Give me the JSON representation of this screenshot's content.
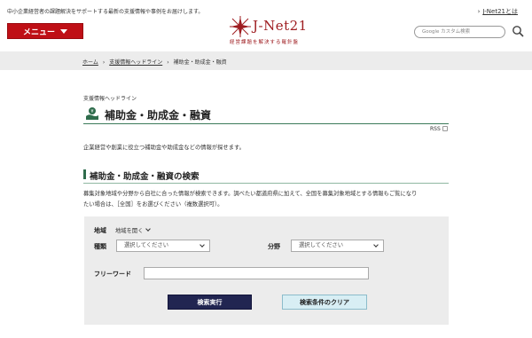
{
  "header": {
    "tagline": "中小企業経営者の課題解決をサポートする最新の支援情報や事例をお届けします。",
    "top_link": "J-Net21とは",
    "menu_label": "メニュー",
    "logo_name": "J-Net21",
    "logo_subtitle": "経営課題を解決する羅針盤",
    "search_placeholder": "Google カスタム検索"
  },
  "breadcrumb": {
    "items": [
      "ホーム",
      "支援情報ヘッドライン",
      "補助金・助成金・融資"
    ],
    "separator": "›"
  },
  "main": {
    "section_label": "支援情報ヘッドライン",
    "title": "補助金・助成金・融資",
    "rss_label": "RSS",
    "intro": "企業経営や創業に役立つ補助金や助成金などの情報が探せます。"
  },
  "search": {
    "title": "補助金・助成金・融資の検索",
    "description_line1": "募集対象地域や分野から自社に合った情報が検索できます。調べたい都道府県に加えて、全国を募集対象地域とする情報もご覧になり",
    "description_line2": "たい場合は、［全国］をお選びください（複数選択可）。",
    "region_label": "地域",
    "region_toggle": "地域を開く",
    "type_label": "種類",
    "type_placeholder": "選択してください",
    "field_label": "分野",
    "field_placeholder": "選択してください",
    "freeword_label": "フリーワード",
    "freeword_value": "",
    "submit_label": "検索実行",
    "clear_label": "検索条件のクリア"
  },
  "colors": {
    "menu_red": "#bf0f16",
    "brand_red": "#9e1c20",
    "accent_green": "#2f6c4c",
    "search_button": "#212551",
    "clear_button": "#d8eef4"
  }
}
